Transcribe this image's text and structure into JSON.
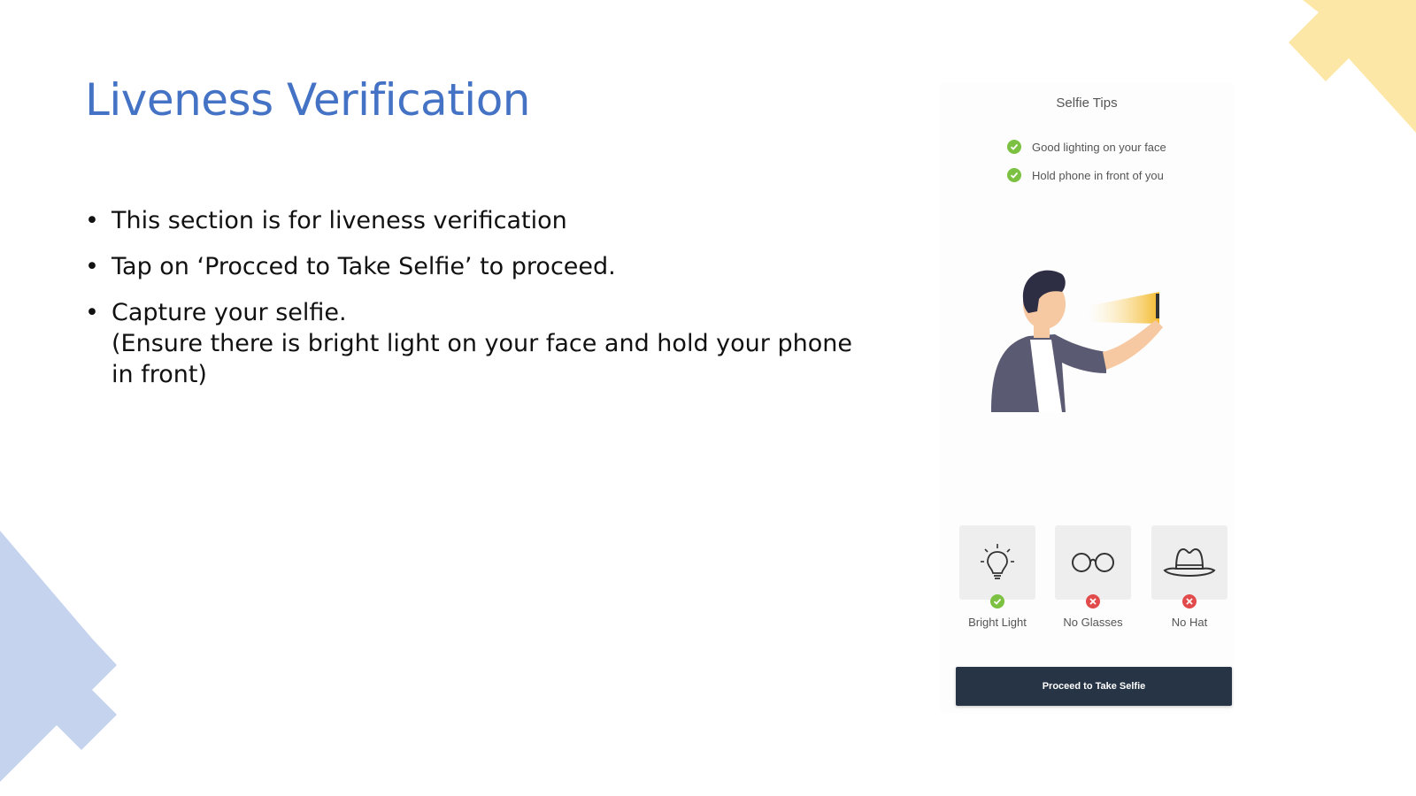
{
  "slide": {
    "title": "Liveness Verification",
    "bullets": [
      {
        "line1": "This section is for liveness verification"
      },
      {
        "line1": "Tap on ‘Procced to Take Selfie’ to proceed."
      },
      {
        "line1": "Capture your selfie.",
        "line2": "(Ensure there is bright light on your face and hold your phone in front)"
      }
    ],
    "colors": {
      "title": "#4472c4",
      "deco_yellow": "#fde7a6",
      "deco_blue": "#c5d3ef"
    }
  },
  "phone": {
    "tips_title": "Selfie Tips",
    "tips": [
      {
        "label": "Good lighting on your face",
        "icon": "check-circle-icon"
      },
      {
        "label": "Hold phone in front of you",
        "icon": "check-circle-icon"
      }
    ],
    "cards": [
      {
        "label": "Bright Light",
        "icon": "lightbulb-icon",
        "status": "ok"
      },
      {
        "label": "No Glasses",
        "icon": "glasses-icon",
        "status": "not-allowed"
      },
      {
        "label": "No Hat",
        "icon": "hat-icon",
        "status": "not-allowed"
      }
    ],
    "proceed_button": "Proceed to Take Selfie",
    "colors": {
      "button": "#263445",
      "ok": "#7cc142",
      "error": "#e24b4b"
    }
  }
}
